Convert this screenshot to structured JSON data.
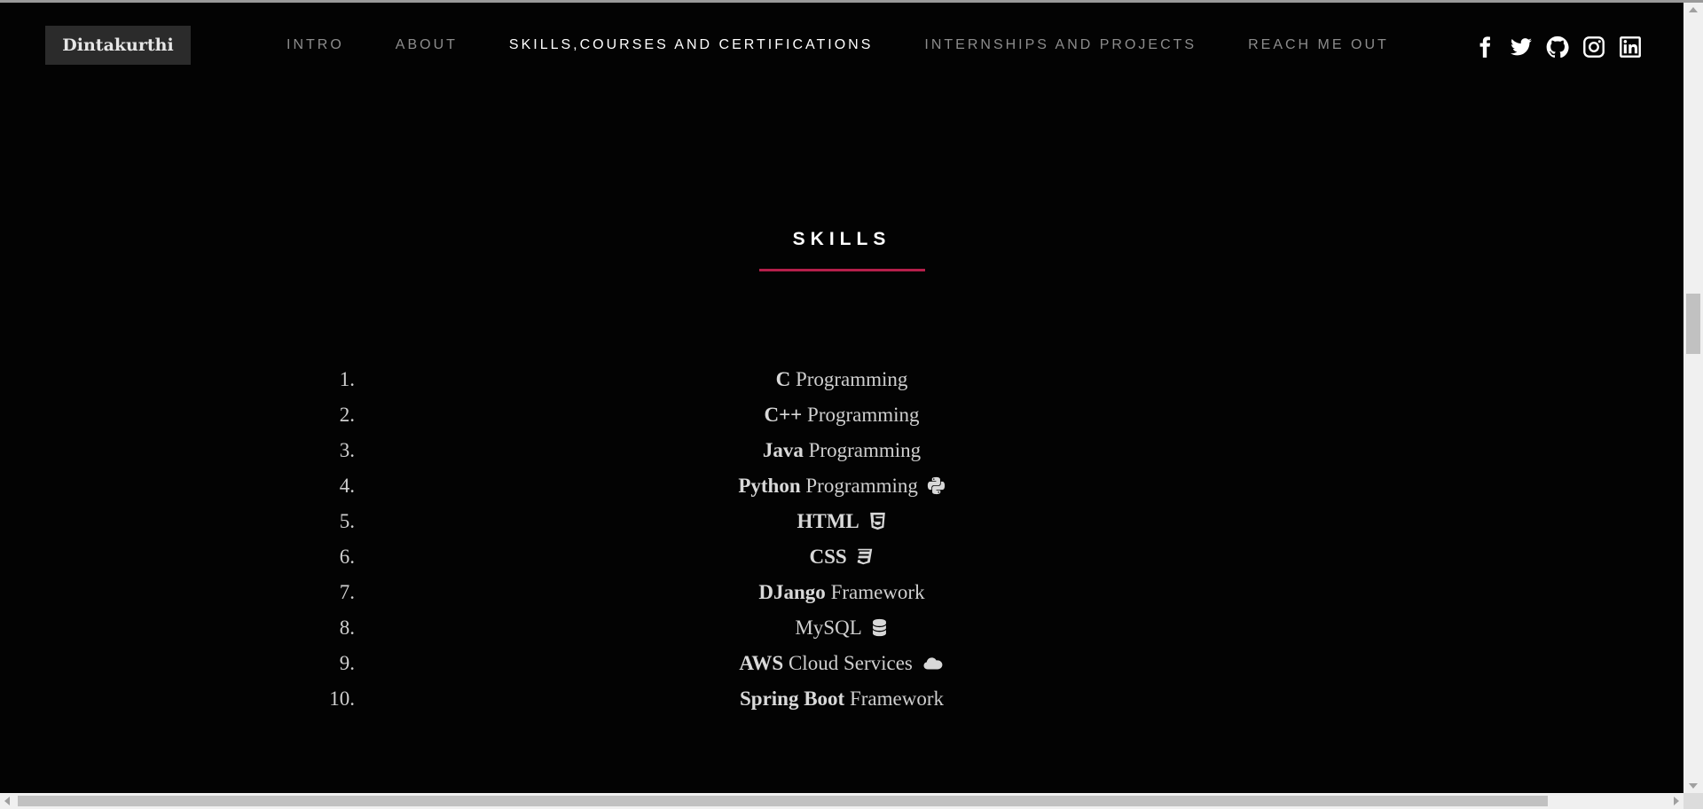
{
  "brand": "Dintakurthi",
  "nav": {
    "items": [
      {
        "label": "INTRO"
      },
      {
        "label": "ABOUT"
      },
      {
        "label": "SKILLS,COURSES AND CERTIFICATIONS"
      },
      {
        "label": "INTERNSHIPS AND PROJECTS"
      },
      {
        "label": "REACH ME OUT"
      }
    ],
    "active_index": 2
  },
  "social_icons": [
    "facebook-icon",
    "twitter-icon",
    "github-icon",
    "instagram-icon",
    "linkedin-icon"
  ],
  "section": {
    "title": "SKILLS",
    "accent_color": "#b51f4a"
  },
  "skills": [
    {
      "num": "1.",
      "bold": "C",
      "rest": " Programming",
      "icon": ""
    },
    {
      "num": "2.",
      "bold": "C++",
      "rest": " Programming",
      "icon": ""
    },
    {
      "num": "3.",
      "bold": "Java",
      "rest": " Programming",
      "icon": ""
    },
    {
      "num": "4.",
      "bold": "Python",
      "rest": " Programming",
      "icon": "python-icon"
    },
    {
      "num": "5.",
      "bold": "HTML",
      "rest": "",
      "icon": "html5-icon"
    },
    {
      "num": "6.",
      "bold": "CSS",
      "rest": "",
      "icon": "css3-icon"
    },
    {
      "num": "7.",
      "bold": "DJango",
      "rest": " Framework",
      "icon": ""
    },
    {
      "num": "8.",
      "bold": "",
      "rest": "MySQL",
      "icon": "database-icon"
    },
    {
      "num": "9.",
      "bold": "AWS",
      "rest": " Cloud Services",
      "icon": "cloud-icon"
    },
    {
      "num": "10.",
      "bold": "Spring Boot",
      "rest": " Framework",
      "icon": ""
    }
  ],
  "colors": {
    "background": "#030303",
    "nav_inactive": "#8c8c8c",
    "nav_active": "#ffffff",
    "brand_bg": "#2b2b2b"
  }
}
